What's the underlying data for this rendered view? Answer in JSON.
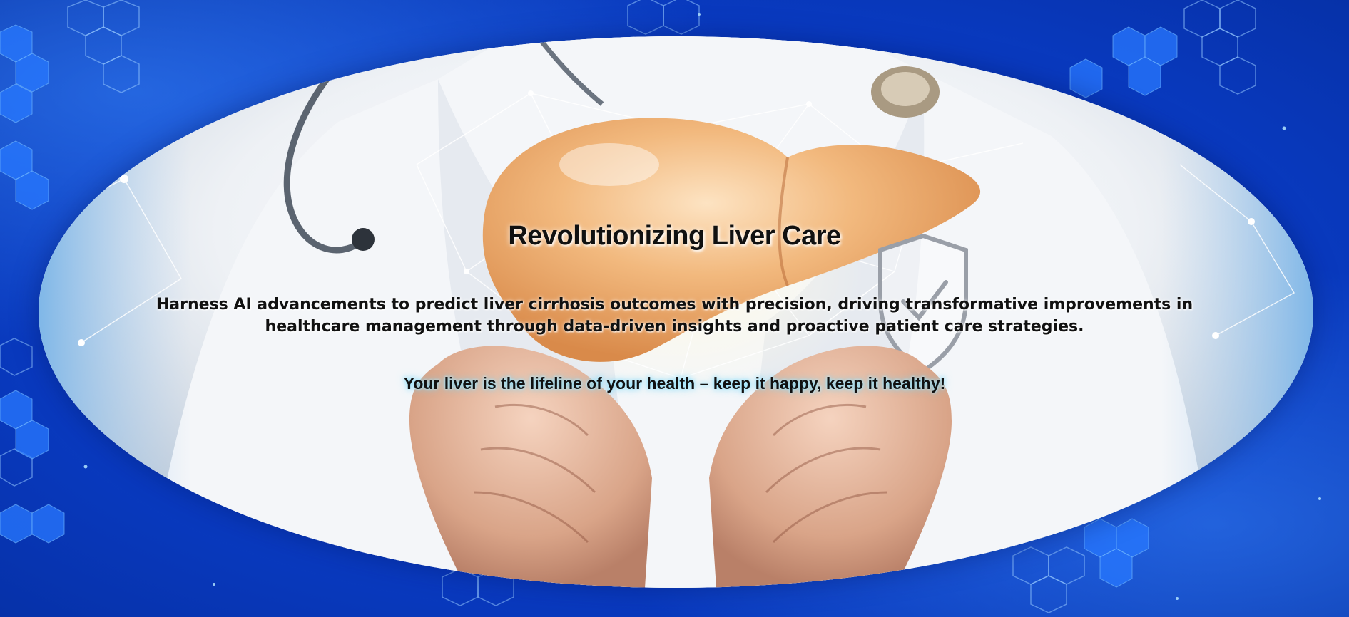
{
  "hero": {
    "title": "Revolutionizing Liver Care",
    "subtitle": "Harness AI advancements to predict liver cirrhosis outcomes with precision, driving transformative improvements in healthcare management through data-driven insights and proactive patient care strategies.",
    "tagline": "Your liver is the lifeline of your health – keep it happy, keep it healthy!"
  },
  "image": {
    "subject": "doctor-holding-liver-illustration",
    "icons": [
      "liver-icon",
      "shield-check-icon",
      "stethoscope-icon",
      "molecule-hexagon-icon"
    ]
  },
  "colors": {
    "background_blue": "#0a3dc8",
    "accent_glow": "#78dcff",
    "text": "#111111"
  }
}
